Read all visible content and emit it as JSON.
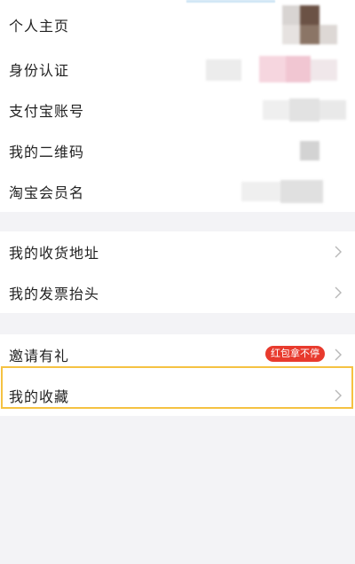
{
  "profile_section": {
    "rows": [
      {
        "label": "个人主页"
      },
      {
        "label": "身份认证"
      },
      {
        "label": "支付宝账号"
      },
      {
        "label": "我的二维码"
      },
      {
        "label": "淘宝会员名"
      }
    ]
  },
  "address_section": {
    "rows": [
      {
        "label": "我的收货地址"
      },
      {
        "label": "我的发票抬头"
      }
    ]
  },
  "extras_section": {
    "invite": {
      "label": "邀请有礼",
      "badge": "红包拿不停"
    },
    "favorites": {
      "label": "我的收藏"
    }
  },
  "colors": {
    "badge_bg": "#e83a2d",
    "highlight_border": "#f5c242",
    "page_bg": "#f3f3f6"
  },
  "icons": {
    "row_chevron": "chevron-right-icon"
  }
}
